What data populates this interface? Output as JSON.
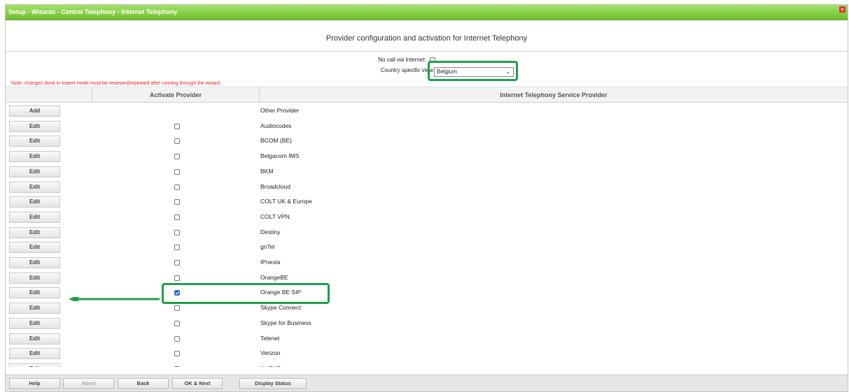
{
  "window": {
    "title": "Setup - Wizards - Central Telephony - Internet Telephony",
    "close_glyph": "×"
  },
  "header": {
    "title": "Provider configuration and activation for Internet Telephony"
  },
  "options": {
    "no_call_label": "No call via Internet:",
    "no_call_checked": false,
    "country_label": "Country specific view:",
    "country_value": "Belgium",
    "caret": "⌄",
    "note": "Note: changes done in expert mode must be reviewed/repeated after running through the wizard."
  },
  "table": {
    "headers": [
      "Activate Provider",
      "Internet Telephony Service Provider"
    ],
    "rows": [
      {
        "button": "Add",
        "name": "Other Provider",
        "has_checkbox": false,
        "checked": false
      },
      {
        "button": "Edit",
        "name": "Audiocodes",
        "has_checkbox": true,
        "checked": false
      },
      {
        "button": "Edit",
        "name": "BCOM (BE)",
        "has_checkbox": true,
        "checked": false
      },
      {
        "button": "Edit",
        "name": "Belgacom IMS",
        "has_checkbox": true,
        "checked": false
      },
      {
        "button": "Edit",
        "name": "BKM",
        "has_checkbox": true,
        "checked": false
      },
      {
        "button": "Edit",
        "name": "Broadcloud",
        "has_checkbox": true,
        "checked": false
      },
      {
        "button": "Edit",
        "name": "COLT UK & Europe",
        "has_checkbox": true,
        "checked": false
      },
      {
        "button": "Edit",
        "name": "COLT VPN",
        "has_checkbox": true,
        "checked": false
      },
      {
        "button": "Edit",
        "name": "Destiny",
        "has_checkbox": true,
        "checked": false
      },
      {
        "button": "Edit",
        "name": "gnTel",
        "has_checkbox": true,
        "checked": false
      },
      {
        "button": "Edit",
        "name": "IPnexia",
        "has_checkbox": true,
        "checked": false
      },
      {
        "button": "Edit",
        "name": "OrangeBE",
        "has_checkbox": true,
        "checked": false
      },
      {
        "button": "Edit",
        "name": "Orange BE SIP",
        "has_checkbox": true,
        "checked": true
      },
      {
        "button": "Edit",
        "name": "Skype Connect",
        "has_checkbox": true,
        "checked": false
      },
      {
        "button": "Edit",
        "name": "Skype for Business",
        "has_checkbox": true,
        "checked": false
      },
      {
        "button": "Edit",
        "name": "Telenet",
        "has_checkbox": true,
        "checked": false
      },
      {
        "button": "Edit",
        "name": "Verizon",
        "has_checkbox": true,
        "checked": false
      },
      {
        "button": "Edit",
        "name": "VoIPXS",
        "has_checkbox": true,
        "checked": false
      }
    ]
  },
  "footer": {
    "buttons": [
      {
        "label": "Help",
        "enabled": true
      },
      {
        "label": "Abort",
        "enabled": false
      },
      {
        "label": "Back",
        "enabled": true
      },
      {
        "label": "OK & Next",
        "enabled": true
      },
      {
        "label": "Display Status",
        "enabled": true
      }
    ]
  },
  "colors": {
    "title_bar": "#7acb34",
    "highlight": "#1f9f4a",
    "note_text": "#e0221c",
    "checkbox_checked": "#2f6cd1"
  }
}
